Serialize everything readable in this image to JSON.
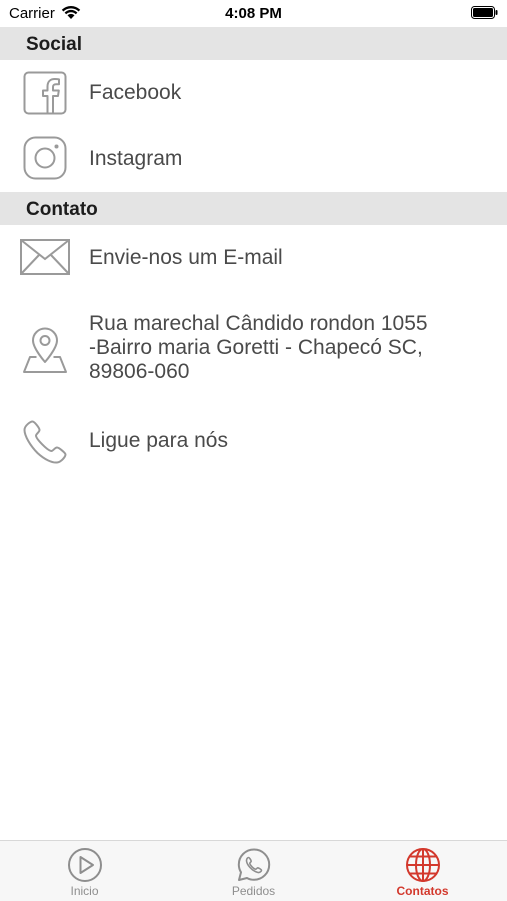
{
  "status_bar": {
    "carrier": "Carrier",
    "time": "4:08 PM"
  },
  "sections": [
    {
      "title": "Social"
    },
    {
      "title": "Contato"
    }
  ],
  "social": {
    "facebook": {
      "label": "Facebook",
      "icon": "facebook-icon"
    },
    "instagram": {
      "label": "Instagram",
      "icon": "instagram-icon"
    }
  },
  "contact": {
    "email": {
      "label": "Envie-nos um E-mail",
      "icon": "mail-icon"
    },
    "address": {
      "line1": "Rua marechal Cândido rondon 1055",
      "line2": "-Bairro maria Goretti - Chapecó SC,",
      "line3": "89806-060",
      "icon": "map-pin-icon"
    },
    "phone": {
      "label": "Ligue para nós",
      "icon": "phone-icon"
    }
  },
  "tabs": [
    {
      "label": "Inicio",
      "icon": "play-icon"
    },
    {
      "label": "Pedidos",
      "icon": "whatsapp-icon"
    },
    {
      "label": "Contatos",
      "icon": "globe-icon",
      "active": true
    }
  ],
  "colors": {
    "accent": "#d3382c",
    "header_bg": "#e4e4e4",
    "icon_gray": "#9a9a9a"
  }
}
